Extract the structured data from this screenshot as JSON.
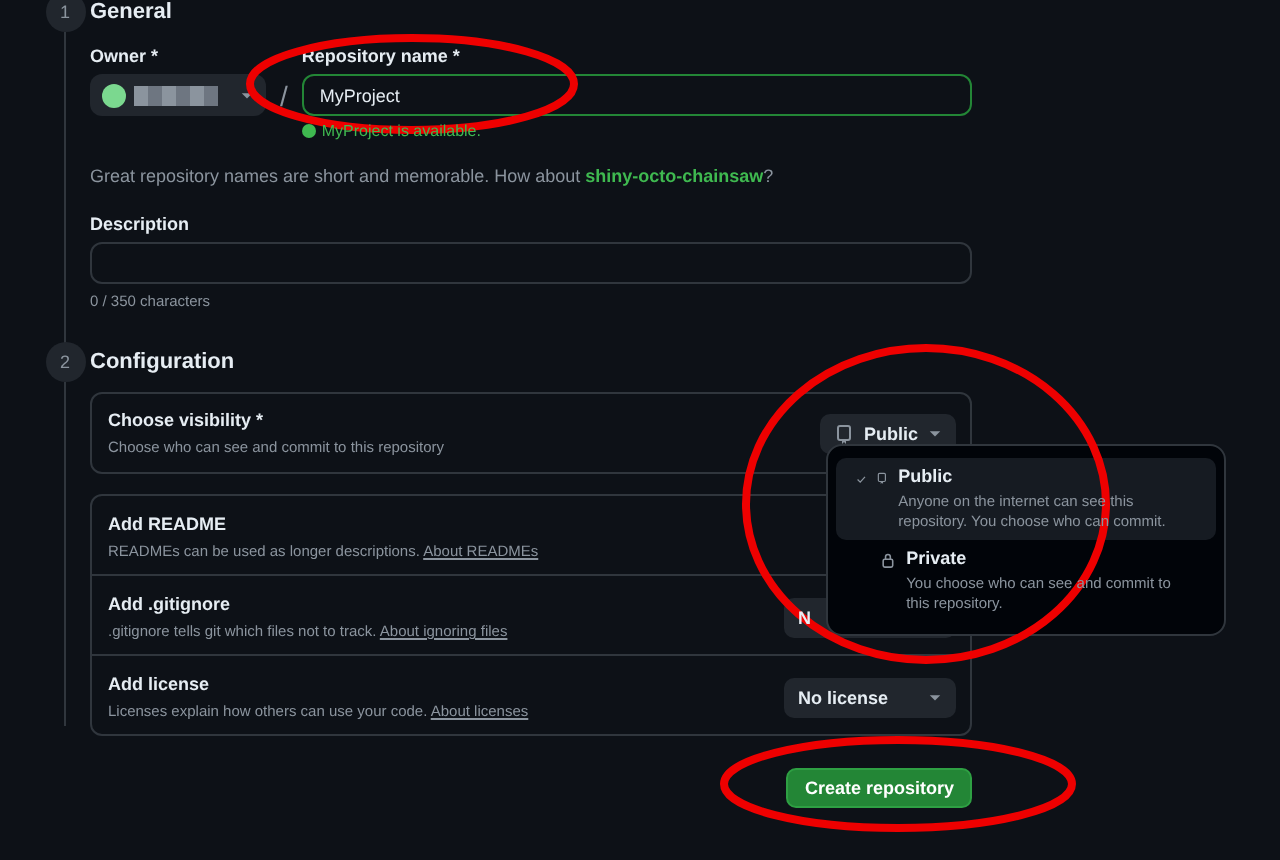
{
  "steps": [
    {
      "number": "1",
      "title": "General"
    },
    {
      "number": "2",
      "title": "Configuration"
    }
  ],
  "owner": {
    "label": "Owner *"
  },
  "separator": "/",
  "repository_name": {
    "label": "Repository name *",
    "value": "MyProject",
    "availability": "MyProject is available."
  },
  "suggestion": {
    "text": "Great repository names are short and memorable. How about ",
    "link": "shiny-octo-chainsaw",
    "end": "?"
  },
  "description": {
    "label": "Description",
    "counter": "0 / 350 characters"
  },
  "settings": [
    {
      "title": "Choose visibility *",
      "text": "Choose who can see and commit to this repository",
      "button": "Public",
      "kind": "visibility"
    },
    {
      "title": "Add README",
      "text": "READMEs can be used as longer descriptions. ",
      "link": "About READMEs",
      "kind": "toggle"
    },
    {
      "title": "Add .gitignore",
      "text": ".gitignore tells git which files not to track. ",
      "link": "About ignoring files",
      "button": "N",
      "kind": "partial"
    },
    {
      "title": "Add license",
      "text": "Licenses explain how others can use your code. ",
      "link": "About licenses",
      "button": "No license",
      "kind": "select"
    }
  ],
  "visibility_menu": [
    {
      "title": "Public",
      "text": "Anyone on the internet can see this repository. You choose who can commit.",
      "selected": true,
      "kind": "repo"
    },
    {
      "title": "Private",
      "text": "You choose who can see and commit to this repository.",
      "selected": false,
      "kind": "lock"
    }
  ],
  "create_button": "Create repository"
}
